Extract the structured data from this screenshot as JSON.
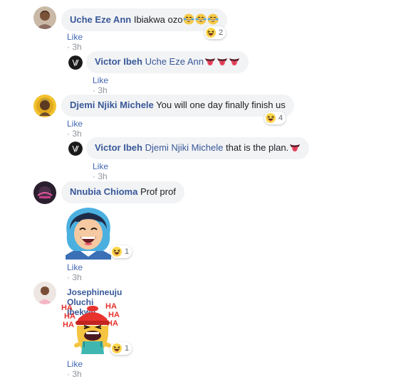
{
  "comments": [
    {
      "author": "Uche Eze Ann",
      "text": "Ibiakwa ozo",
      "emojis": [
        "laughing-tears",
        "laughing-tears",
        "laughing-tears"
      ],
      "like_label": "Like",
      "separator": "·",
      "time": "3h",
      "reaction": {
        "icon": "haha-reaction-icon",
        "count": "2"
      }
    },
    {
      "author": "Victor Ibeh",
      "mention": "Uche Eze Ann",
      "emojis": [
        "tongue",
        "tongue",
        "tongue"
      ],
      "like_label": "Like",
      "separator": "·",
      "time": "3h"
    },
    {
      "author": "Djemi Njiki Michele",
      "text": "You will one day finally finish us",
      "like_label": "Like",
      "separator": "·",
      "time": "3h",
      "reaction": {
        "icon": "haha-reaction-icon",
        "count": "4"
      }
    },
    {
      "author": "Victor Ibeh",
      "mention": "Djemi Njiki Michele",
      "text": "that is the plan.",
      "emojis": [
        "tongue"
      ],
      "like_label": "Like",
      "separator": "·",
      "time": "3h"
    },
    {
      "author": "Nnubia Chioma",
      "text": "Prof prof",
      "sticker": "laughing-woman-sticker",
      "like_label": "Like",
      "separator": "·",
      "time": "3h",
      "reaction": {
        "icon": "haha-reaction-icon",
        "count": "1"
      }
    },
    {
      "author": "Josephineuju Oluchi Ibekwe",
      "sticker": "haha-laughing-character-sticker",
      "sticker_text": [
        "HA",
        "HA",
        "HA",
        "HA",
        "HA",
        "HA"
      ],
      "like_label": "Like",
      "separator": "·",
      "time": "3h",
      "reaction": {
        "icon": "haha-reaction-icon",
        "count": "1"
      }
    }
  ],
  "colors": {
    "name": "#385898",
    "like": "#4267b2",
    "bubble": "#f2f3f5",
    "meta": "#90949c"
  }
}
